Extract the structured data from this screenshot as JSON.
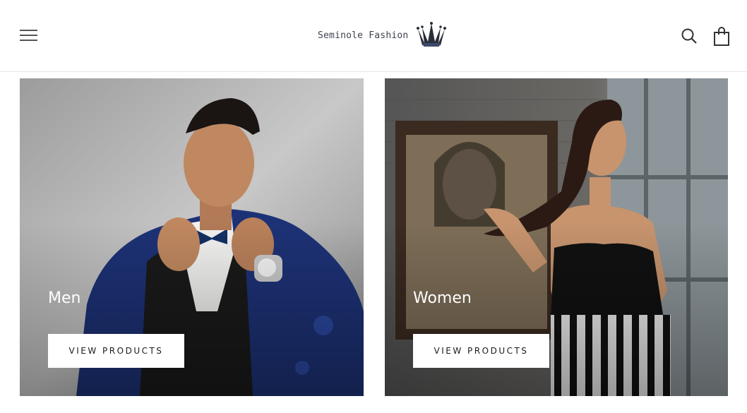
{
  "header": {
    "menu_icon": "hamburger-menu-icon",
    "logo_text": "Seminole Fashion",
    "logo_icon": "crown-icon",
    "search_icon": "search-icon",
    "cart_icon": "shopping-bag-icon"
  },
  "collections": [
    {
      "title": "Men",
      "button_label": "VIEW PRODUCTS"
    },
    {
      "title": "Women",
      "button_label": "VIEW PRODUCTS"
    }
  ],
  "colors": {
    "header_bg": "#ffffff",
    "border": "#e6e6e6",
    "button_bg": "#ffffff",
    "text_dark": "#1c1b1b",
    "logo_blue": "#3f4350"
  }
}
